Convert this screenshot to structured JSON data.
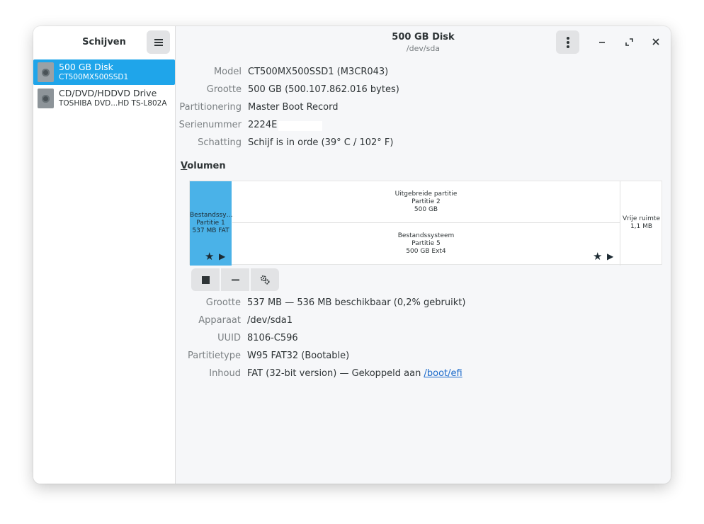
{
  "sidebar": {
    "title": "Schijven",
    "menu_icon": "hamburger-icon",
    "disks": [
      {
        "name": "500 GB Disk",
        "sub": "CT500MX500SSD1"
      },
      {
        "name": "CD/DVD/HDDVD Drive",
        "sub": "TOSHIBA DVD...HD TS-L802A"
      }
    ]
  },
  "header": {
    "title": "500 GB Disk",
    "subtitle": "/dev/sda"
  },
  "disk_info": {
    "model_label": "Model",
    "model": "CT500MX500SSD1 (M3CR043)",
    "size_label": "Grootte",
    "size": "500 GB (500.107.862.016 bytes)",
    "partitioning_label": "Partitionering",
    "partitioning": "Master Boot Record",
    "serial_label": "Serienummer",
    "serial": "2224E",
    "assessment_label": "Schatting",
    "assessment": "Schijf is in orde (39° C / 102° F)"
  },
  "volumes": {
    "title_first": "V",
    "title_rest": "olumen",
    "partition1": {
      "line1": "Bestandssy…",
      "line2": "Partitie 1",
      "line3": "537 MB FAT"
    },
    "extended": {
      "line1": "Uitgebreide partitie",
      "line2": "Partitie 2",
      "line3": "500 GB"
    },
    "partition5": {
      "line1": "Bestandssysteem",
      "line2": "Partitie 5",
      "line3": "500 GB Ext4"
    },
    "free": {
      "line1": "Vrije ruimte",
      "line2": "1,1 MB"
    },
    "star_glyph": "★",
    "play_glyph": "▶",
    "selected_color": "#4ab2e8"
  },
  "partition_info": {
    "size_label": "Grootte",
    "size": "537 MB — 536 MB beschikbaar (0,2% gebruikt)",
    "device_label": "Apparaat",
    "device": "/dev/sda1",
    "uuid_label": "UUID",
    "uuid": "8106-C596",
    "type_label": "Partitietype",
    "type": "W95 FAT32 (Bootable)",
    "content_label": "Inhoud",
    "content_prefix": "FAT (32-bit version) — Gekoppeld aan ",
    "mount_point": "/boot/efi"
  },
  "colors": {
    "accent": "#1fa5ea",
    "link": "#1b6acb"
  }
}
